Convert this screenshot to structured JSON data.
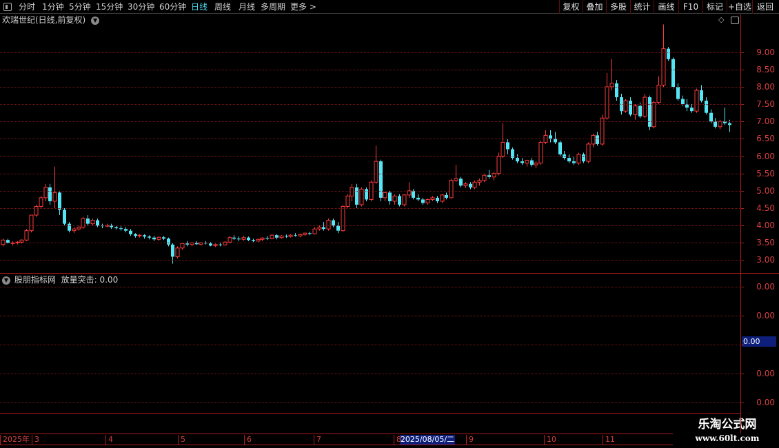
{
  "toolbar": {
    "periods": [
      {
        "label": "分时",
        "active": false
      },
      {
        "label": "1分钟",
        "active": false
      },
      {
        "label": "5分钟",
        "active": false
      },
      {
        "label": "15分钟",
        "active": false
      },
      {
        "label": "30分钟",
        "active": false
      },
      {
        "label": "60分钟",
        "active": false
      },
      {
        "label": "日线",
        "active": true
      },
      {
        "label": "周线",
        "active": false
      },
      {
        "label": "月线",
        "active": false
      },
      {
        "label": "多周期",
        "active": false
      },
      {
        "label": "更多 >",
        "active": false
      }
    ],
    "actions": [
      "复权",
      "叠加",
      "多股",
      "统计",
      "画线",
      "F10",
      "标记",
      "+自选",
      "返回"
    ]
  },
  "main_pane": {
    "title": "欢瑞世纪(日线,前复权)",
    "icons": [
      "chevron-down-icon",
      "diamond-icon",
      "panel-toggle-icon"
    ]
  },
  "sub_pane": {
    "title": "股朋指标网",
    "indicator": "放量突击: 0.00",
    "value_label": "0.00",
    "ticks": [
      "0.00",
      "0.00",
      "0.00",
      "0.00"
    ]
  },
  "date_axis": {
    "labels": [
      "2025年",
      "3",
      "4",
      "5",
      "6",
      "7",
      "8",
      "9",
      "10",
      "11"
    ],
    "cursor": "2025/08/05/二"
  },
  "watermark": {
    "line1": "乐淘公式网",
    "line2": "www.60lt.com"
  },
  "colors": {
    "up": "#ff3c3c",
    "down": "#55e6f5",
    "grid": "#7a1a1a",
    "axis_text": "#d84040",
    "active": "#4fd2e8"
  },
  "chart_data": {
    "type": "candlestick",
    "title": "欢瑞世纪(日线,前复权)",
    "y_ticks": [
      3.0,
      3.5,
      4.0,
      4.5,
      5.0,
      5.5,
      6.0,
      6.5,
      7.0,
      7.5,
      8.0,
      8.5,
      9.0
    ],
    "ylim": [
      2.75,
      9.75
    ],
    "grid": true,
    "note": "Daily OHLC, Feb-Dec 2025, values estimated from chart",
    "series": [
      {
        "name": "daily",
        "ohlc": [
          [
            3.45,
            3.62,
            3.4,
            3.58
          ],
          [
            3.58,
            3.62,
            3.48,
            3.5
          ],
          [
            3.5,
            3.55,
            3.42,
            3.5
          ],
          [
            3.5,
            3.55,
            3.45,
            3.52
          ],
          [
            3.52,
            3.6,
            3.48,
            3.58
          ],
          [
            3.58,
            3.9,
            3.55,
            3.85
          ],
          [
            3.85,
            4.0,
            3.8,
            4.3
          ],
          [
            4.3,
            4.6,
            4.25,
            4.55
          ],
          [
            4.55,
            4.85,
            4.5,
            4.8
          ],
          [
            4.8,
            5.2,
            4.7,
            5.1
          ],
          [
            5.1,
            5.2,
            4.6,
            4.7
          ],
          [
            4.7,
            5.7,
            4.5,
            4.95
          ],
          [
            4.95,
            5.0,
            4.3,
            4.45
          ],
          [
            4.45,
            4.5,
            4.0,
            4.05
          ],
          [
            4.05,
            4.1,
            3.8,
            3.85
          ],
          [
            3.85,
            3.95,
            3.78,
            3.9
          ],
          [
            3.9,
            4.0,
            3.85,
            3.95
          ],
          [
            3.95,
            4.25,
            3.9,
            4.2
          ],
          [
            4.2,
            4.3,
            4.0,
            4.05
          ],
          [
            4.05,
            4.2,
            4.0,
            4.15
          ],
          [
            4.15,
            4.2,
            3.95,
            4.0
          ],
          [
            4.0,
            4.05,
            3.92,
            3.98
          ],
          [
            3.98,
            4.05,
            3.95,
            4.0
          ],
          [
            4.0,
            4.05,
            3.9,
            3.95
          ],
          [
            3.95,
            4.0,
            3.88,
            3.92
          ],
          [
            3.92,
            3.98,
            3.85,
            3.9
          ],
          [
            3.9,
            3.95,
            3.8,
            3.85
          ],
          [
            3.85,
            3.9,
            3.7,
            3.75
          ],
          [
            3.75,
            3.78,
            3.65,
            3.7
          ],
          [
            3.7,
            3.75,
            3.65,
            3.72
          ],
          [
            3.72,
            3.75,
            3.62,
            3.68
          ],
          [
            3.68,
            3.72,
            3.6,
            3.65
          ],
          [
            3.65,
            3.7,
            3.55,
            3.6
          ],
          [
            3.6,
            3.68,
            3.55,
            3.66
          ],
          [
            3.66,
            3.7,
            3.58,
            3.62
          ],
          [
            3.62,
            3.65,
            3.4,
            3.45
          ],
          [
            3.45,
            3.5,
            2.9,
            3.1
          ],
          [
            3.1,
            3.4,
            3.05,
            3.35
          ],
          [
            3.35,
            3.5,
            3.3,
            3.48
          ],
          [
            3.48,
            3.55,
            3.4,
            3.45
          ],
          [
            3.45,
            3.52,
            3.4,
            3.5
          ],
          [
            3.5,
            3.55,
            3.44,
            3.46
          ],
          [
            3.46,
            3.52,
            3.42,
            3.5
          ],
          [
            3.5,
            3.55,
            3.45,
            3.48
          ],
          [
            3.48,
            3.52,
            3.4,
            3.42
          ],
          [
            3.42,
            3.48,
            3.38,
            3.45
          ],
          [
            3.45,
            3.5,
            3.4,
            3.44
          ],
          [
            3.44,
            3.55,
            3.42,
            3.52
          ],
          [
            3.52,
            3.7,
            3.5,
            3.65
          ],
          [
            3.65,
            3.72,
            3.58,
            3.62
          ],
          [
            3.62,
            3.68,
            3.55,
            3.6
          ],
          [
            3.6,
            3.7,
            3.56,
            3.65
          ],
          [
            3.65,
            3.68,
            3.55,
            3.58
          ],
          [
            3.58,
            3.62,
            3.52,
            3.55
          ],
          [
            3.55,
            3.62,
            3.52,
            3.6
          ],
          [
            3.6,
            3.66,
            3.55,
            3.64
          ],
          [
            3.64,
            3.7,
            3.58,
            3.62
          ],
          [
            3.62,
            3.75,
            3.6,
            3.72
          ],
          [
            3.72,
            3.75,
            3.6,
            3.65
          ],
          [
            3.65,
            3.72,
            3.62,
            3.7
          ],
          [
            3.7,
            3.74,
            3.64,
            3.68
          ],
          [
            3.68,
            3.75,
            3.65,
            3.72
          ],
          [
            3.72,
            3.78,
            3.68,
            3.7
          ],
          [
            3.7,
            3.76,
            3.66,
            3.74
          ],
          [
            3.74,
            3.8,
            3.7,
            3.78
          ],
          [
            3.78,
            3.82,
            3.72,
            3.76
          ],
          [
            3.76,
            3.95,
            3.74,
            3.9
          ],
          [
            3.9,
            4.0,
            3.85,
            3.95
          ],
          [
            3.95,
            4.1,
            3.85,
            3.9
          ],
          [
            3.9,
            4.2,
            3.85,
            4.15
          ],
          [
            4.15,
            4.2,
            3.95,
            4.0
          ],
          [
            4.0,
            4.1,
            3.78,
            3.85
          ],
          [
            3.85,
            4.6,
            3.82,
            4.55
          ],
          [
            4.55,
            4.9,
            4.5,
            4.85
          ],
          [
            4.85,
            5.2,
            4.7,
            5.1
          ],
          [
            5.1,
            5.2,
            4.5,
            4.6
          ],
          [
            4.6,
            5.1,
            4.55,
            5.05
          ],
          [
            5.05,
            5.1,
            4.7,
            4.75
          ],
          [
            4.75,
            5.3,
            4.7,
            5.25
          ],
          [
            5.25,
            6.3,
            5.2,
            5.85
          ],
          [
            5.85,
            5.9,
            4.7,
            4.8
          ],
          [
            4.8,
            5.0,
            4.7,
            4.95
          ],
          [
            4.95,
            5.0,
            4.6,
            4.7
          ],
          [
            4.7,
            4.9,
            4.6,
            4.85
          ],
          [
            4.85,
            4.9,
            4.55,
            4.6
          ],
          [
            4.6,
            4.9,
            4.55,
            4.88
          ],
          [
            4.88,
            5.25,
            4.8,
            5.0
          ],
          [
            5.0,
            5.05,
            4.75,
            4.8
          ],
          [
            4.8,
            4.9,
            4.7,
            4.75
          ],
          [
            4.75,
            4.8,
            4.6,
            4.65
          ],
          [
            4.65,
            4.78,
            4.6,
            4.75
          ],
          [
            4.75,
            4.85,
            4.7,
            4.8
          ],
          [
            4.8,
            4.85,
            4.65,
            4.7
          ],
          [
            4.7,
            4.9,
            4.65,
            4.88
          ],
          [
            4.88,
            4.95,
            4.75,
            4.8
          ],
          [
            4.8,
            5.35,
            4.78,
            5.3
          ],
          [
            5.3,
            5.75,
            5.25,
            5.35
          ],
          [
            5.35,
            5.4,
            5.1,
            5.15
          ],
          [
            5.15,
            5.25,
            5.08,
            5.2
          ],
          [
            5.2,
            5.25,
            5.05,
            5.1
          ],
          [
            5.1,
            5.3,
            5.05,
            5.25
          ],
          [
            5.25,
            5.35,
            5.15,
            5.3
          ],
          [
            5.3,
            5.5,
            5.25,
            5.45
          ],
          [
            5.45,
            5.6,
            5.35,
            5.4
          ],
          [
            5.4,
            5.55,
            5.3,
            5.5
          ],
          [
            5.5,
            6.1,
            5.45,
            6.0
          ],
          [
            6.0,
            6.95,
            5.95,
            6.4
          ],
          [
            6.4,
            6.5,
            6.05,
            6.2
          ],
          [
            6.2,
            6.25,
            5.9,
            5.95
          ],
          [
            5.95,
            6.05,
            5.8,
            5.85
          ],
          [
            5.85,
            5.95,
            5.75,
            5.8
          ],
          [
            5.8,
            5.9,
            5.7,
            5.88
          ],
          [
            5.88,
            5.95,
            5.7,
            5.75
          ],
          [
            5.75,
            5.85,
            5.65,
            5.8
          ],
          [
            5.8,
            6.45,
            5.75,
            6.4
          ],
          [
            6.4,
            6.75,
            6.35,
            6.6
          ],
          [
            6.6,
            6.75,
            6.4,
            6.5
          ],
          [
            6.5,
            6.7,
            6.35,
            6.4
          ],
          [
            6.4,
            6.45,
            6.0,
            6.05
          ],
          [
            6.05,
            6.15,
            5.9,
            5.95
          ],
          [
            5.95,
            6.05,
            5.8,
            5.85
          ],
          [
            5.85,
            6.0,
            5.75,
            5.8
          ],
          [
            5.8,
            6.1,
            5.75,
            6.05
          ],
          [
            6.05,
            6.1,
            5.8,
            5.85
          ],
          [
            5.85,
            6.4,
            5.8,
            6.35
          ],
          [
            6.35,
            6.65,
            6.25,
            6.6
          ],
          [
            6.6,
            6.7,
            6.3,
            6.35
          ],
          [
            6.35,
            7.2,
            6.3,
            7.1
          ],
          [
            7.1,
            8.4,
            7.05,
            8.0
          ],
          [
            8.0,
            8.8,
            7.9,
            8.1
          ],
          [
            8.1,
            8.2,
            7.6,
            7.7
          ],
          [
            7.7,
            7.8,
            7.2,
            7.3
          ],
          [
            7.3,
            7.65,
            7.25,
            7.6
          ],
          [
            7.6,
            7.7,
            7.15,
            7.2
          ],
          [
            7.2,
            7.5,
            7.05,
            7.45
          ],
          [
            7.45,
            7.55,
            7.1,
            7.15
          ],
          [
            7.15,
            7.8,
            7.1,
            7.7
          ],
          [
            7.7,
            7.75,
            6.75,
            6.85
          ],
          [
            6.85,
            7.6,
            6.8,
            7.55
          ],
          [
            7.55,
            8.3,
            7.5,
            8.05
          ],
          [
            8.05,
            9.8,
            8.0,
            9.1
          ],
          [
            9.1,
            9.15,
            8.75,
            8.8
          ],
          [
            8.8,
            8.85,
            7.95,
            8.0
          ],
          [
            8.0,
            8.1,
            7.6,
            7.65
          ],
          [
            7.65,
            7.75,
            7.45,
            7.5
          ],
          [
            7.5,
            7.65,
            7.3,
            7.4
          ],
          [
            7.4,
            7.5,
            7.25,
            7.3
          ],
          [
            7.3,
            7.95,
            7.25,
            7.9
          ],
          [
            7.9,
            8.05,
            7.55,
            7.6
          ],
          [
            7.6,
            7.7,
            7.2,
            7.25
          ],
          [
            7.25,
            7.35,
            6.95,
            7.0
          ],
          [
            7.0,
            7.1,
            6.8,
            6.85
          ],
          [
            6.85,
            7.05,
            6.78,
            7.0
          ],
          [
            7.0,
            7.4,
            6.9,
            6.95
          ],
          [
            6.95,
            7.05,
            6.7,
            6.9
          ]
        ]
      }
    ]
  }
}
